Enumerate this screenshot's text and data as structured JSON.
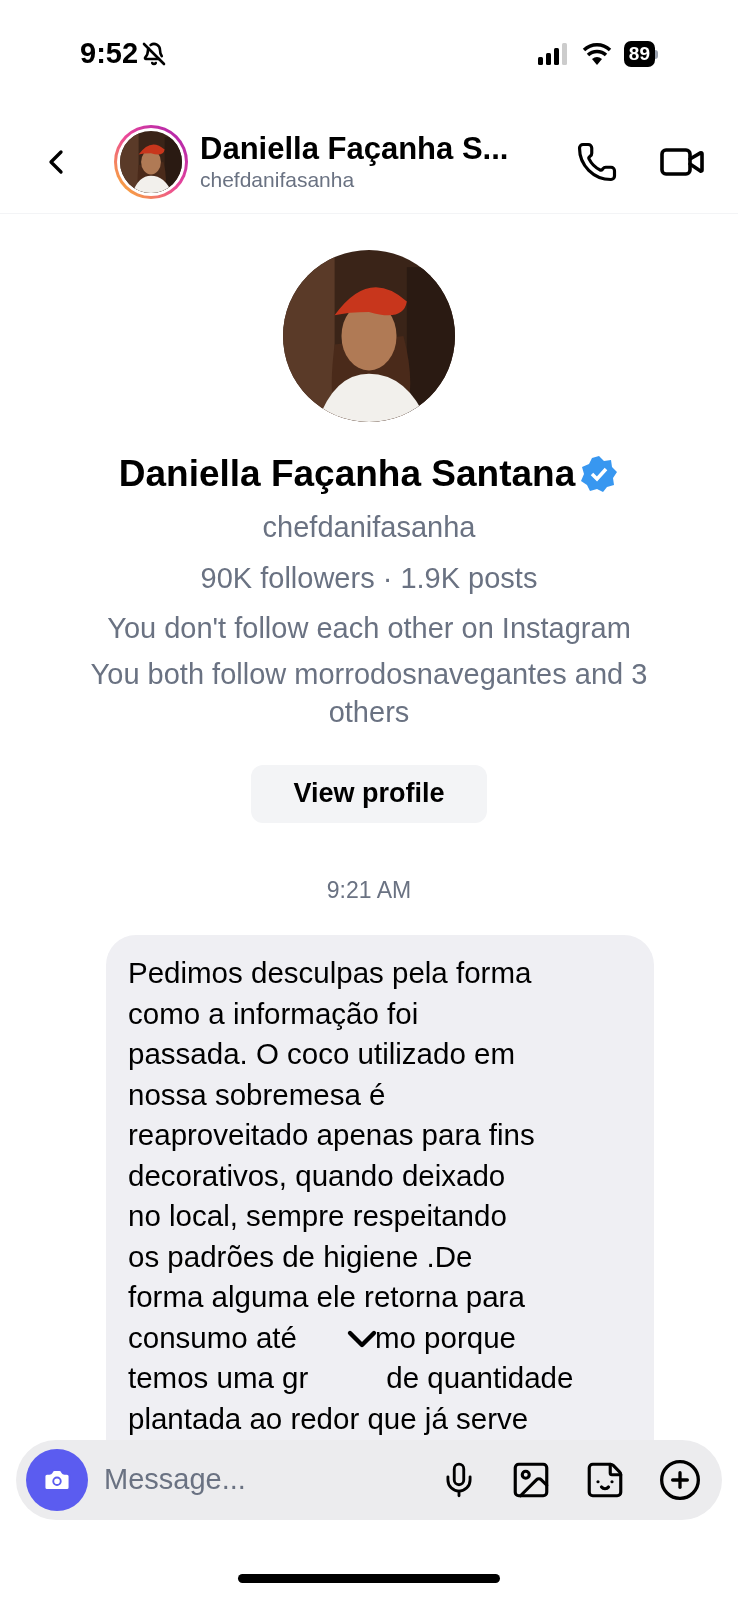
{
  "status_bar": {
    "time": "9:52",
    "battery": "89"
  },
  "header": {
    "name": "Daniella Façanha S...",
    "username": "chefdanifasanha"
  },
  "profile": {
    "name": "Daniella Façanha Santana",
    "verified": true,
    "username": "chefdanifasanha",
    "stats": "90K followers · 1.9K posts",
    "mutual_lines": [
      "You don't follow each other on Instagram",
      "You both follow morrodosnavegantes and 3 others"
    ],
    "button": "View profile"
  },
  "timestamp": "9:21 AM",
  "message": {
    "lines": [
      [
        "Pedimos desculpas pela forma"
      ],
      [
        "como a informação foi"
      ],
      [
        "passada. O coco utilizado em"
      ],
      [
        "nossa sobremesa é"
      ],
      [
        "reaproveitado apenas para fins"
      ],
      [
        "decorativos, quando deixado"
      ],
      [
        "no local, sempre respeitando"
      ],
      [
        "os padrões de higiene .De"
      ],
      [
        "forma alguma ele retorna para"
      ],
      [
        "consumo até",
        "mo porque"
      ],
      [
        "temos uma gr",
        "de quantidade"
      ],
      [
        "plantada ao redor que já serve"
      ]
    ]
  },
  "composer": {
    "placeholder": "Message..."
  }
}
